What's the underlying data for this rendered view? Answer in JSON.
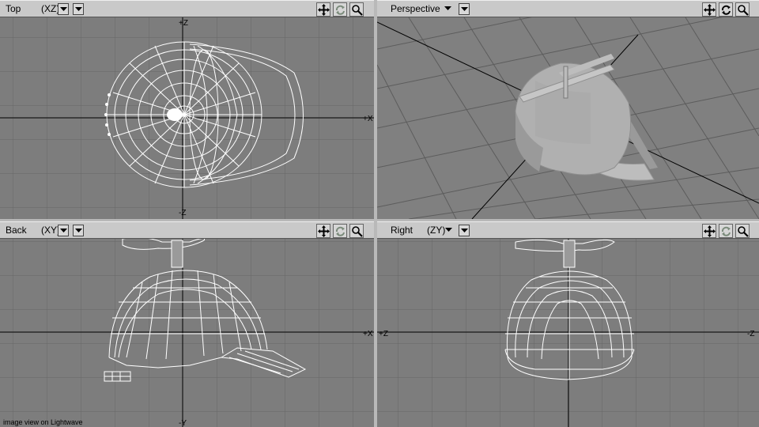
{
  "viewports": {
    "top": {
      "name": "Top",
      "axis": "(XZ)"
    },
    "perspective": {
      "name": "Perspective",
      "axis": ""
    },
    "back": {
      "name": "Back",
      "axis": "(XY)"
    },
    "right": {
      "name": "Right",
      "axis": "(ZY)"
    }
  },
  "icons": [
    "dropdown-arrow-icon",
    "move-view-icon",
    "rotate-view-icon",
    "zoom-view-icon"
  ],
  "caption": "image view on Lightwave",
  "colors": {
    "viewport_bg": "#7d7d7d",
    "header_bg": "#c9c9c9",
    "grid": "#666666",
    "wire": "#ffffff",
    "axis": "#000000"
  }
}
